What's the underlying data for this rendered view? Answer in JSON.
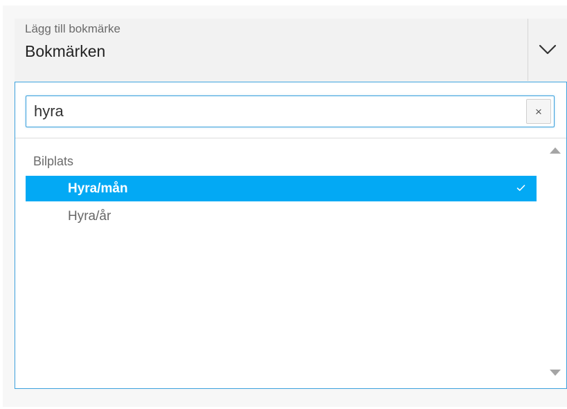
{
  "field": {
    "label": "Lägg till bokmärke",
    "value": "Bokmärken"
  },
  "search": {
    "value": "hyra",
    "clear_label": "×"
  },
  "list": {
    "group": "Bilplats",
    "options": [
      {
        "label": "Hyra/mån",
        "selected": true
      },
      {
        "label": "Hyra/år",
        "selected": false
      }
    ]
  },
  "icons": {
    "dropdown": "chevron-down-icon",
    "selected": "checkmark-icon",
    "scroll_up": "scroll-up-arrow-icon",
    "scroll_down": "scroll-down-arrow-icon"
  },
  "colors": {
    "accent": "#03a9f4",
    "border": "#3aa0dc"
  }
}
